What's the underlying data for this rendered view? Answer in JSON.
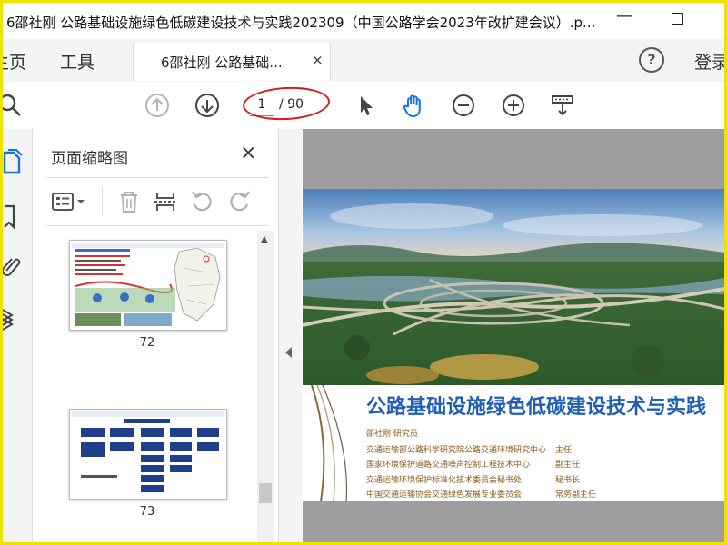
{
  "window": {
    "title": "6邵社刚  公路基础设施绿色低碳建设技术与实践202309（中国公路学会2023年改扩建会议）.p...",
    "minimize_glyph": "—"
  },
  "tabbar": {
    "home_label": "主页",
    "tools_label": "工具",
    "doc_tab_label": "6邵社刚  公路基础...",
    "doc_tab_close": "×",
    "help_glyph": "?",
    "login_label": "登录"
  },
  "toolbar": {
    "current_page": "1",
    "total_pages": "/ 90"
  },
  "thumbnails": {
    "title": "页面缩略图",
    "close_glyph": "×",
    "items": [
      {
        "page": "72"
      },
      {
        "page": "73"
      }
    ]
  },
  "slide": {
    "title": "公路基础设施绿色低碳建设技术与实践",
    "presenter": "邵社刚   研究员",
    "affiliations": [
      {
        "org": "交通运输部公路科学研究院公路交通环境研究中心",
        "role": "主任"
      },
      {
        "org": "国家环境保护道路交通噪声控制工程技术中心",
        "role": "副主任"
      },
      {
        "org": "交通运输环境保护标准化技术委员会秘书处",
        "role": "秘书长"
      },
      {
        "org": "中国交通运输协会交通绿色发展专业委员会",
        "role": "常务副主任"
      }
    ]
  },
  "colors": {
    "frame_border": "#f2e100",
    "annotation_red": "#d61a1a",
    "slide_title_blue": "#1f5fb8",
    "hand_tool_blue": "#1473e6"
  }
}
